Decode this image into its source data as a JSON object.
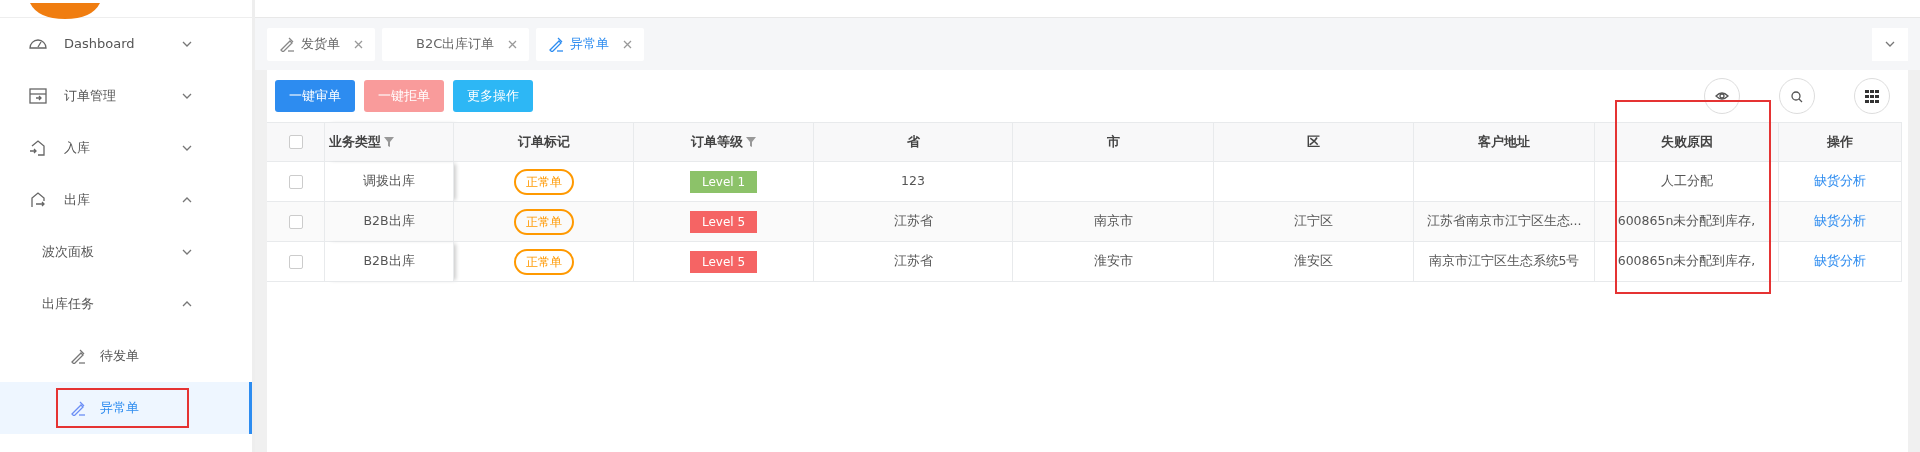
{
  "sidebar": {
    "items": [
      {
        "label": "Dashboard",
        "expanded": false,
        "selected": false,
        "highlighted": false
      },
      {
        "label": "订单管理",
        "expanded": false,
        "selected": false,
        "highlighted": false
      },
      {
        "label": "入库",
        "expanded": false,
        "selected": false,
        "highlighted": false
      },
      {
        "label": "出库",
        "expanded": true,
        "selected": false,
        "highlighted": false,
        "children": [
          {
            "label": "波次面板",
            "expanded": false,
            "selected": false,
            "highlighted": false
          },
          {
            "label": "出库任务",
            "expanded": true,
            "selected": false,
            "highlighted": false,
            "children": [
              {
                "label": "待发单",
                "selected": false,
                "highlighted": false
              },
              {
                "label": "异常单",
                "selected": true,
                "highlighted": true
              }
            ]
          }
        ]
      }
    ]
  },
  "tabs": [
    {
      "label": "发货单",
      "icon": true,
      "selected": false
    },
    {
      "label": "B2C出库订单",
      "icon": false,
      "selected": false
    },
    {
      "label": "异常单",
      "icon": true,
      "selected": true
    }
  ],
  "toolbar": {
    "buttons": [
      {
        "label": "一键审单",
        "kind": "primary"
      },
      {
        "label": "一键拒单",
        "kind": "danger"
      },
      {
        "label": "更多操作",
        "kind": "info"
      }
    ]
  },
  "table": {
    "all_checked": false,
    "columns": [
      {
        "label": "业务类型",
        "filter": true,
        "highlighted": false
      },
      {
        "label": "订单标记",
        "filter": false,
        "highlighted": false
      },
      {
        "label": "订单等级",
        "filter": true,
        "highlighted": false
      },
      {
        "label": "省",
        "filter": false,
        "highlighted": false
      },
      {
        "label": "市",
        "filter": false,
        "highlighted": false
      },
      {
        "label": "区",
        "filter": false,
        "highlighted": false
      },
      {
        "label": "客户地址",
        "filter": false,
        "highlighted": false
      },
      {
        "label": "失败原因",
        "filter": false,
        "highlighted": true
      },
      {
        "label": "操作",
        "filter": false,
        "highlighted": false
      }
    ],
    "rows": [
      {
        "checked": false,
        "type": "调拨出库",
        "mark": "正常单",
        "level": "Level 1",
        "color": "#8cc269",
        "province": "123",
        "city": "",
        "district": "",
        "address": "",
        "reason": "人工分配",
        "action": "缺货分析"
      },
      {
        "checked": false,
        "type": "B2B出库",
        "mark": "正常单",
        "level": "Level 5",
        "color": "#f56464",
        "province": "江苏省",
        "city": "南京市",
        "district": "江宁区",
        "address": "江苏省南京市江宁区生态...",
        "reason": "600865n未分配到库存,",
        "action": "缺货分析"
      },
      {
        "checked": false,
        "type": "B2B出库",
        "mark": "正常单",
        "level": "Level 5",
        "color": "#f56464",
        "province": "江苏省",
        "city": "淮安市",
        "district": "淮安区",
        "address": "南京市江宁区生态系统5号",
        "reason": "600865n未分配到库存,",
        "action": "缺货分析"
      }
    ]
  }
}
